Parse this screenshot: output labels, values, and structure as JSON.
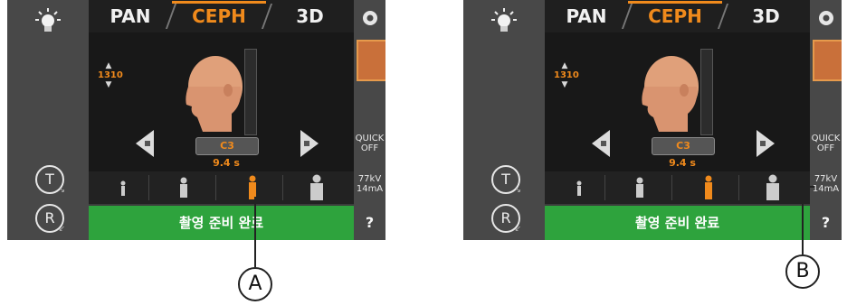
{
  "tabs": [
    "PAN",
    "CEPH",
    "3D"
  ],
  "active_tab": "CEPH",
  "distance_value": "1310",
  "mode_button": "C3",
  "exposure_time": "9.4 s",
  "status_message": "촬영 준비 완료",
  "quick_label": [
    "QUICK",
    "OFF"
  ],
  "kv_label": "77kV",
  "ma_label": "14mA",
  "help_label": "?",
  "t_label": "T",
  "r_label": "R",
  "callouts": {
    "a": "A",
    "b": "B"
  },
  "colors": {
    "accent": "#f08a1c",
    "status_green": "#2ea33d",
    "panel_bg": "#3b3b3b"
  }
}
